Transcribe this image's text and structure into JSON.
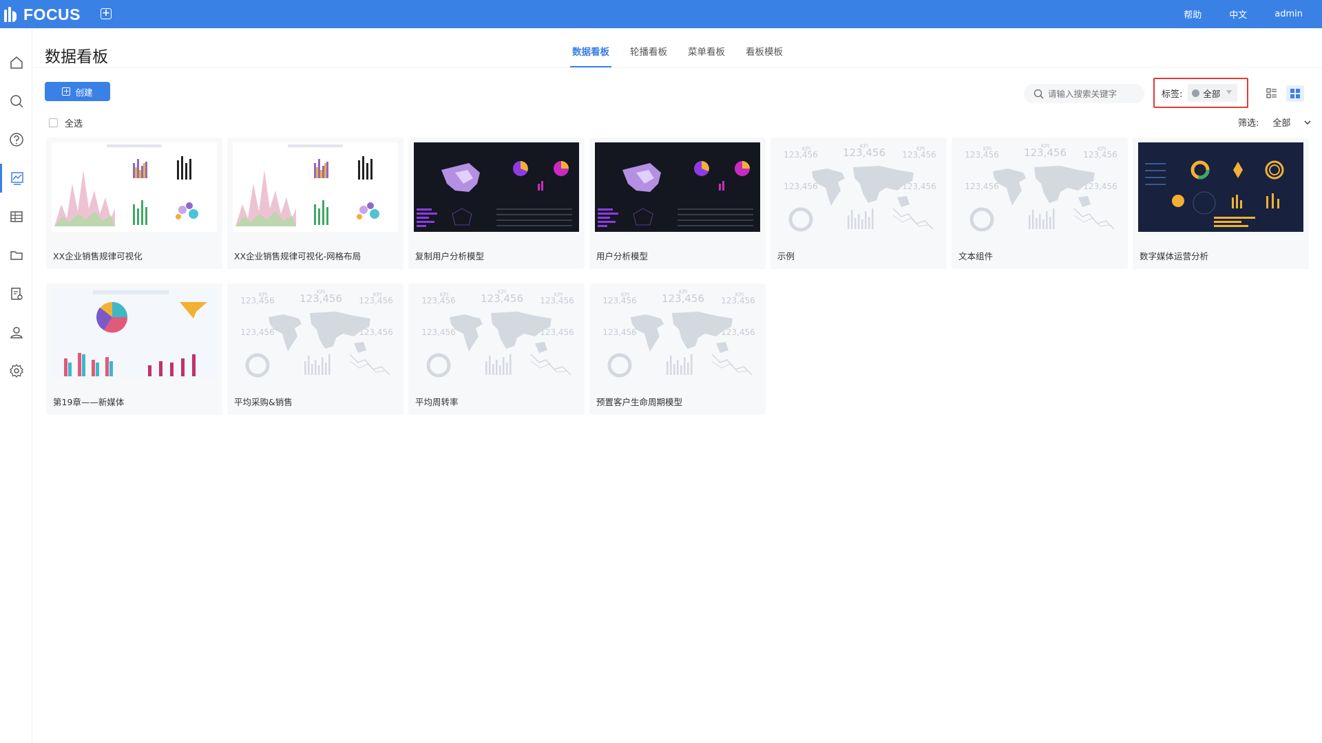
{
  "app": {
    "logo": "FOCUS"
  },
  "header": {
    "links": [
      "帮助",
      "中文",
      "admin"
    ]
  },
  "page": {
    "title": "数据看板"
  },
  "tabs": [
    "数据看板",
    "轮播看板",
    "菜单看板",
    "看板模板"
  ],
  "toolbar": {
    "create_label": "创建",
    "search_placeholder": "请输入搜索关键字",
    "tag_label": "标签:",
    "tag_value": "全部",
    "select_all_label": "全选",
    "filter_label": "筛选:",
    "filter_value": "全部"
  },
  "placeholder_text": {
    "kpi": "KPI",
    "value": "123,456"
  },
  "cards": [
    {
      "title": "XX企业销售规律可视化",
      "thumb": "white"
    },
    {
      "title": "XX企业销售规律可视化-网格布局",
      "thumb": "white"
    },
    {
      "title": "复制用户分析模型",
      "thumb": "dark"
    },
    {
      "title": "用户分析模型",
      "thumb": "dark"
    },
    {
      "title": "示例",
      "thumb": "placeholder"
    },
    {
      "title": "文本组件",
      "thumb": "placeholder"
    },
    {
      "title": "数字媒体运营分析",
      "thumb": "navy"
    },
    {
      "title": "第19章——新媒体",
      "thumb": "white"
    },
    {
      "title": "平均采购&销售",
      "thumb": "placeholder"
    },
    {
      "title": "平均周转率",
      "thumb": "placeholder"
    },
    {
      "title": "预置客户生命周期模型",
      "thumb": "placeholder"
    }
  ],
  "colors": {
    "primary": "#3a81e6",
    "highlight_border": "#e53935"
  }
}
